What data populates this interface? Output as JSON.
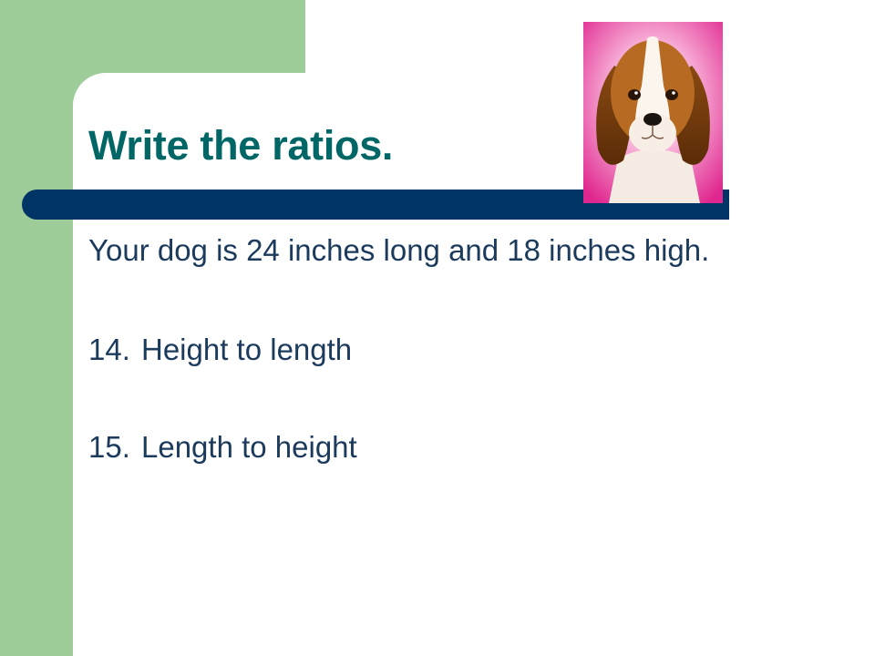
{
  "slide": {
    "title": "Write the ratios.",
    "intro": "Your dog is 24 inches long and 18 inches high.",
    "questions": [
      {
        "number": "14.",
        "text": "Height to length"
      },
      {
        "number": "15.",
        "text": "Length to height"
      }
    ]
  },
  "icons": {
    "photo": "dog-photo"
  },
  "colors": {
    "green": "#9ecd9a",
    "title": "#006666",
    "bar": "#003366",
    "text": "#1b3a5c",
    "photo_bg": "#e8379b"
  }
}
